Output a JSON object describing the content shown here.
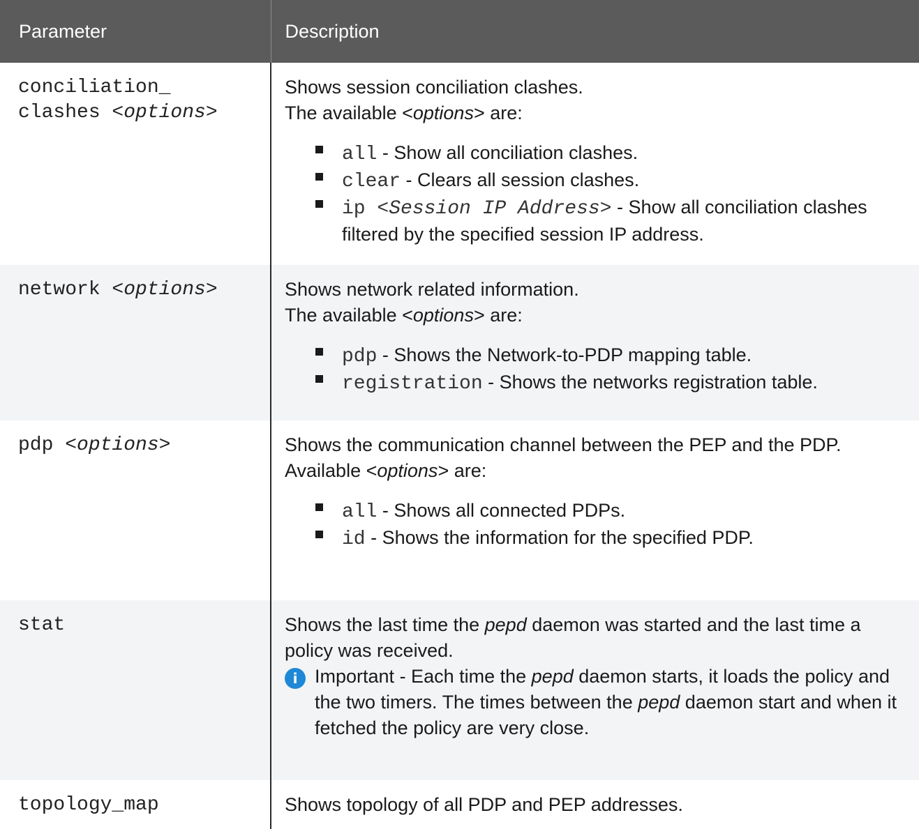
{
  "header": {
    "col1": "Parameter",
    "col2": "Description"
  },
  "rows": [
    {
      "param_text": "conciliation_\nclashes ",
      "param_opt": "<options>",
      "desc_line1": "Shows session conciliation clashes.",
      "desc_line2_pre": "The available <",
      "desc_line2_em": "options",
      "desc_line2_post": "> are:",
      "items": [
        {
          "code": "all",
          "code_em": "",
          "text": " - Show all conciliation clashes."
        },
        {
          "code": "clear",
          "code_em": "",
          "text": " - Clears all session clashes."
        },
        {
          "code": "ip ",
          "code_em": "<Session IP Address>",
          "text": " - Show all conciliation clashes filtered by the specified session IP address."
        }
      ]
    },
    {
      "param_text": "network ",
      "param_opt": "<options>",
      "desc_line1": "Shows network related information.",
      "desc_line2_pre": "The available <",
      "desc_line2_em": "options",
      "desc_line2_post": "> are:",
      "items": [
        {
          "code": "pdp",
          "text": " - Shows the Network-to-PDP mapping table."
        },
        {
          "code": "registration",
          "text": " - Shows the networks registration table."
        }
      ]
    },
    {
      "param_text": "pdp ",
      "param_opt": "<options>",
      "desc_line1": "Shows the communication channel between the PEP and the PDP.",
      "desc_line2_pre": "Available <",
      "desc_line2_em": "options",
      "desc_line2_post": "> are:",
      "items": [
        {
          "code": "all",
          "text": " - Shows all connected PDPs."
        },
        {
          "code": "id",
          "text": " - Shows the information for the specified PDP."
        }
      ]
    },
    {
      "param_text": "stat",
      "desc_pre": "Shows the last time the ",
      "desc_em": "pepd",
      "desc_post": " daemon was started and the last time a policy was received.",
      "note_icon": "info-icon",
      "note_label": "Important",
      "note_t1": " - Each time the ",
      "note_em1": "pepd",
      "note_t2": " daemon starts, it loads the policy and the two timers. The times between the ",
      "note_em2": "pepd",
      "note_t3": " daemon start and when it fetched the policy are very close."
    },
    {
      "param_text": "topology_map",
      "desc": "Shows topology of all PDP and PEP addresses."
    }
  ]
}
